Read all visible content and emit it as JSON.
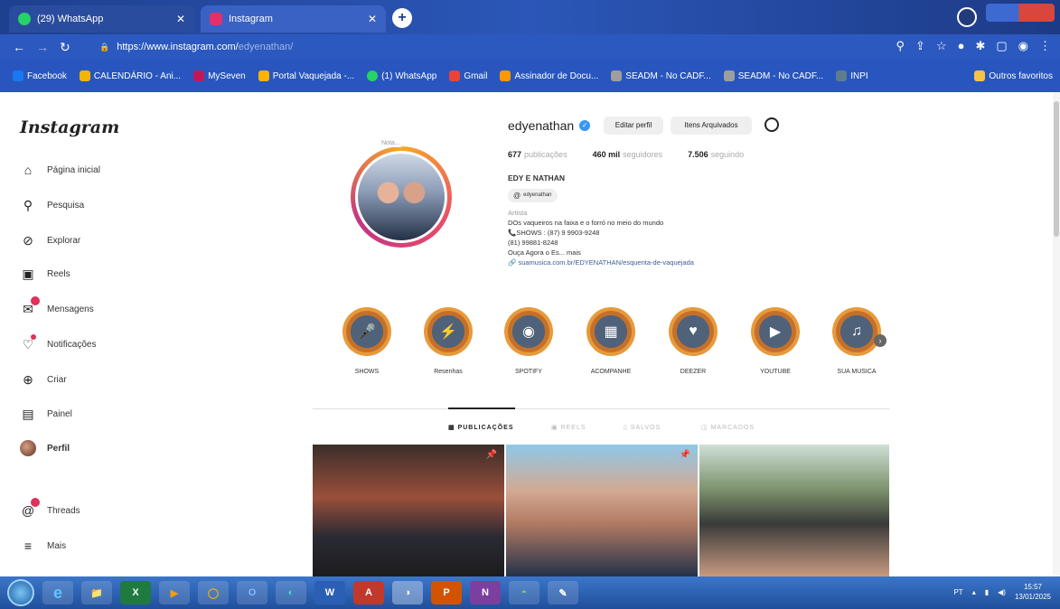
{
  "browser": {
    "tabs": [
      {
        "label": "(29) WhatsApp",
        "color": "#25d366"
      },
      {
        "label": "Instagram",
        "color": "#e1306c"
      }
    ],
    "url_host": "https://www.instagram.com/",
    "url_path": "edyenathan/",
    "bookmarks": [
      {
        "label": "Facebook",
        "color": "#1877f2"
      },
      {
        "label": "CALENDÁRIO - Ani...",
        "color": "#f4b400"
      },
      {
        "label": "MySeven",
        "color": "#c2185b"
      },
      {
        "label": "Portal Vaquejada -...",
        "color": "#ffb300"
      },
      {
        "label": "(1) WhatsApp",
        "color": "#25d366"
      },
      {
        "label": "Gmail",
        "color": "#ea4335"
      },
      {
        "label": "Assinador de Docu...",
        "color": "#ff9800"
      },
      {
        "label": "SEADM - No CADF...",
        "color": "#9e9e9e"
      },
      {
        "label": "SEADM - No CADF...",
        "color": "#9e9e9e"
      },
      {
        "label": "INPI",
        "color": "#607d8b"
      }
    ],
    "bookmarks_more": "Outros favoritos"
  },
  "sidebar": {
    "logo": "Instagram",
    "items": [
      {
        "label": "Página inicial",
        "icon": "⌂"
      },
      {
        "label": "Pesquisa",
        "icon": "⚲"
      },
      {
        "label": "Explorar",
        "icon": "⊘"
      },
      {
        "label": "Reels",
        "icon": "▣"
      },
      {
        "label": "Mensagens",
        "icon": "✉"
      },
      {
        "label": "Notificações",
        "icon": "♡"
      },
      {
        "label": "Criar",
        "icon": "⊕"
      },
      {
        "label": "Painel",
        "icon": "▤"
      },
      {
        "label": "Perfil",
        "icon": ""
      },
      {
        "label": "Threads",
        "icon": "@"
      },
      {
        "label": "Mais",
        "icon": "≡"
      }
    ]
  },
  "profile": {
    "username": "edyenathan",
    "edit_label": "Editar perfil",
    "archive_label": "Itens Arquivados",
    "note": "Nota...",
    "posts_count": "677",
    "posts_label": "publicações",
    "followers_count": "460 mil",
    "followers_label": "seguidores",
    "following_count": "7.506",
    "following_label": "seguindo",
    "display_name": "EDY E NATHAN",
    "threads_handle": "edyenathan",
    "category": "Artista",
    "bio_lines": [
      "DOs vaqueiros na faixa e o forró no meio do mundo",
      "📞SHOWS : (87) 9 9903-9248",
      "(81) 99881-8248",
      "Ouça Agora o Es... mais"
    ],
    "link": "suamusica.com.br/EDYENATHAN/esquenta-de-vaquejada"
  },
  "highlights": [
    {
      "label": "SHOWS",
      "icon": "🎤"
    },
    {
      "label": "Resenhas",
      "icon": "⚡"
    },
    {
      "label": "SPOTIFY",
      "icon": "◉"
    },
    {
      "label": "ACOMPANHE",
      "icon": "▦"
    },
    {
      "label": "DEEZER",
      "icon": "♥"
    },
    {
      "label": "YOUTUBE",
      "icon": "▶"
    },
    {
      "label": "SUA MUSICA",
      "icon": "♫"
    }
  ],
  "content_tabs": [
    {
      "label": "PUBLICAÇÕES",
      "active": true
    },
    {
      "label": "REELS",
      "active": false
    },
    {
      "label": "SALVOS",
      "active": false
    },
    {
      "label": "MARCADOS",
      "active": false
    }
  ],
  "taskbar": {
    "apps": [
      "e",
      "📁",
      "X",
      "▶",
      "◯",
      "O",
      "◐",
      "W",
      "A",
      "◑",
      "P",
      "N",
      "◓",
      "✎"
    ],
    "lang": "PT",
    "time": "15:57",
    "date": "13/01/2025"
  }
}
